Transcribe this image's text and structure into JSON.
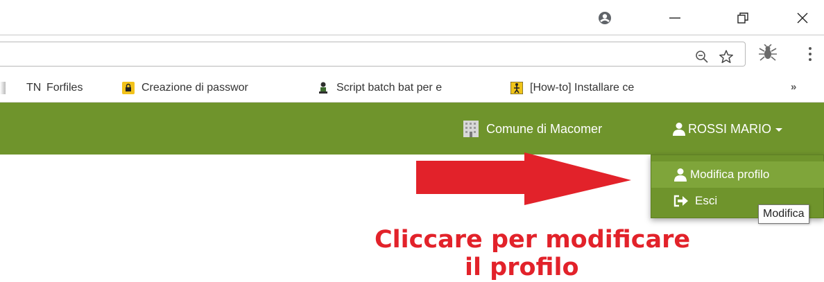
{
  "window": {
    "controls": [
      "account-icon",
      "minimize-icon",
      "restore-icon",
      "close-icon"
    ]
  },
  "toolbar": {
    "icons": [
      "zoom-out-icon",
      "bookmark-star-icon",
      "extension-icon",
      "menu-icon"
    ]
  },
  "bookmarks": {
    "items": [
      {
        "label": "TN",
        "icon": "text"
      },
      {
        "label": "Forfiles",
        "icon": "none"
      },
      {
        "label": "Creazione di passwor",
        "icon": "lock-icon"
      },
      {
        "label": "Script batch bat per e",
        "icon": "person-icon"
      },
      {
        "label": "[How-to] Installare ce",
        "icon": "figure-icon"
      }
    ],
    "overflow": "»"
  },
  "navbar": {
    "organization": "Comune di Macomer",
    "user": "ROSSI MARIO",
    "background": "#6f942c"
  },
  "dropdown": {
    "items": [
      {
        "label": "Modifica profilo",
        "icon": "user-icon"
      },
      {
        "label": "Esci",
        "icon": "sign-out-icon"
      }
    ],
    "tooltip": "Modifica"
  },
  "annotation": {
    "line1": "Cliccare per modificare",
    "line2": "il profilo",
    "color": "#e2222a"
  }
}
